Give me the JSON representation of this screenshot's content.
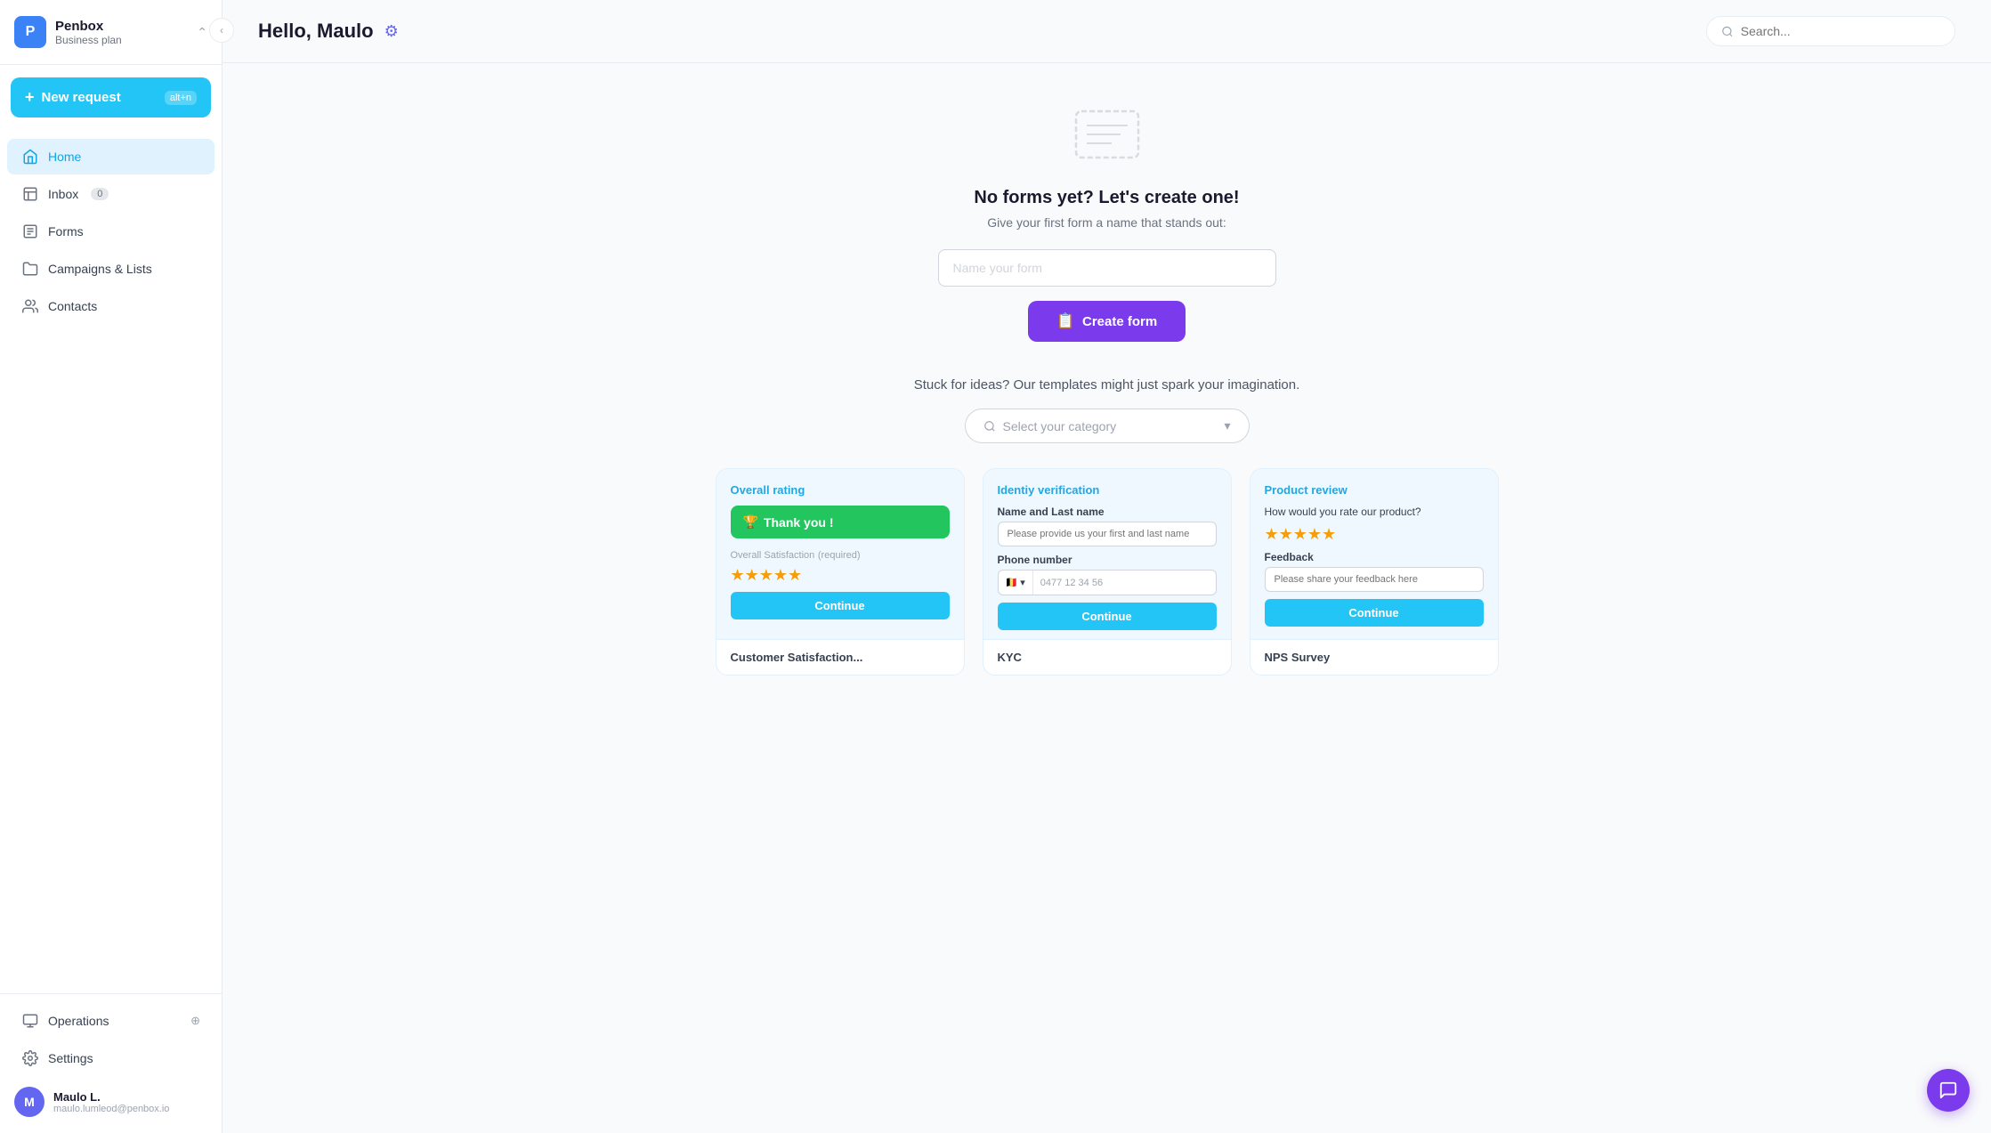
{
  "sidebar": {
    "avatar_letter": "P",
    "brand_name": "Penbox",
    "brand_plan": "Business plan",
    "collapse_arrow": "‹",
    "new_request_label": "New request",
    "new_request_badge": "alt+n",
    "nav_items": [
      {
        "id": "home",
        "label": "Home",
        "icon": "🏠",
        "active": true
      },
      {
        "id": "inbox",
        "label": "Inbox",
        "icon": "☐",
        "badge": "0"
      },
      {
        "id": "forms",
        "label": "Forms",
        "icon": "📋"
      },
      {
        "id": "campaigns",
        "label": "Campaigns & Lists",
        "icon": "📁"
      },
      {
        "id": "contacts",
        "label": "Contacts",
        "icon": "👥"
      }
    ],
    "bottom_nav": [
      {
        "id": "operations",
        "label": "Operations",
        "icon": "⚙"
      },
      {
        "id": "settings",
        "label": "Settings",
        "icon": "⚙"
      }
    ],
    "user": {
      "letter": "M",
      "name": "Maulo L.",
      "email": "maulo.lumleod@penbox.io"
    }
  },
  "header": {
    "greeting": "Hello, Maulo",
    "search_placeholder": "Search..."
  },
  "empty_state": {
    "title": "No forms yet? Let's create one!",
    "subtitle": "Give your first form a name that stands out:",
    "input_placeholder": "Name your form",
    "create_btn_label": "Create form"
  },
  "templates": {
    "tagline": "Stuck for ideas? Our templates might just spark your imagination.",
    "category_placeholder": "Select your category",
    "cards": [
      {
        "id": "overall-rating",
        "label": "Overall rating",
        "footer": "Customer Satisfaction...",
        "thankyou": "Thank you !",
        "satisfaction": "Overall Satisfaction",
        "satisfaction_note": "(required)",
        "stars": "★★★★★",
        "continue": "Continue"
      },
      {
        "id": "identity-verification",
        "label": "Identiy verification",
        "footer": "KYC",
        "name_label": "Name and Last name",
        "name_placeholder": "Please provide us your first and last name",
        "phone_label": "Phone number",
        "phone_flag": "🇧🇪",
        "phone_code": "▾",
        "phone_placeholder": "0477 12 34 56",
        "continue": "Continue"
      },
      {
        "id": "product-review",
        "label": "Product review",
        "footer": "NPS Survey",
        "product_question": "How would you rate our product?",
        "stars": "★★★★★",
        "feedback_label": "Feedback",
        "feedback_placeholder": "Please share your feedback here",
        "continue": "Continue"
      }
    ]
  }
}
